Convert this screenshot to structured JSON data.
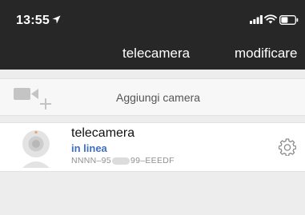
{
  "status_bar": {
    "time": "13:55",
    "icons": [
      "location-arrow-icon",
      "signal-bars-icon",
      "wifi-icon",
      "battery-icon"
    ]
  },
  "nav": {
    "title": "telecamera",
    "edit_label": "modificare"
  },
  "add_camera": {
    "label": "Aggiungi camera",
    "icon": "add-video-camera-icon"
  },
  "cameras": [
    {
      "name": "telecamera",
      "status": "in linea",
      "id_prefix": "NNNN–95",
      "id_suffix": "99–EEEDF",
      "icon": "webcam-icon",
      "settings_icon": "gear-icon"
    }
  ],
  "colors": {
    "bar_background": "#272727",
    "page_background": "#ededed",
    "status_online": "#3f6fc4"
  }
}
